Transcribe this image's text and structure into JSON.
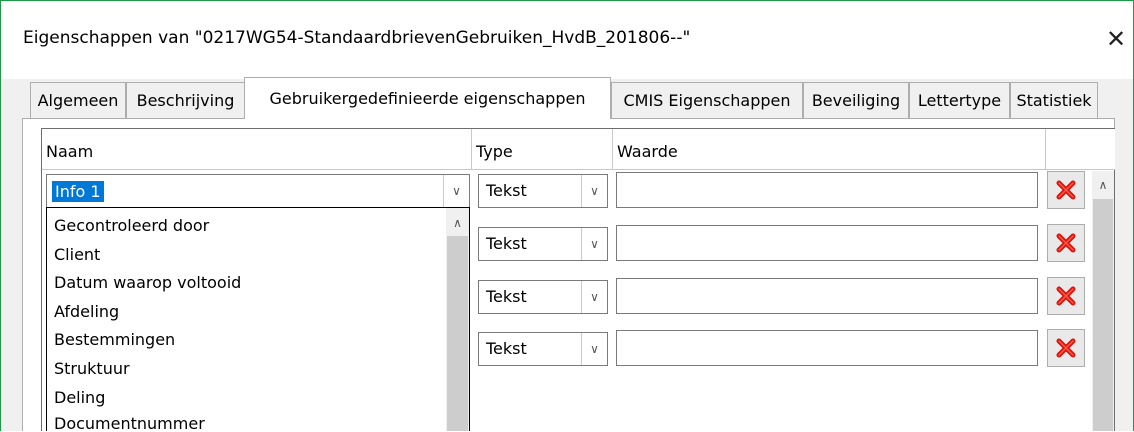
{
  "window": {
    "title": "Eigenschappen van \"0217WG54-StandaardbrievenGebruiken_HvdB_201806--\"",
    "close_glyph": "✕"
  },
  "tabs": [
    {
      "label": "Algemeen"
    },
    {
      "label": "Beschrijving"
    },
    {
      "label": "Gebruikergedefinieerde eigenschappen",
      "active": true
    },
    {
      "label": "CMIS Eigenschappen"
    },
    {
      "label": "Beveiliging"
    },
    {
      "label": "Lettertype"
    },
    {
      "label": "Statistiek"
    }
  ],
  "table": {
    "headers": {
      "name": "Naam",
      "type": "Type",
      "value": "Waarde"
    },
    "rows": [
      {
        "name": "Info 1",
        "type": "Tekst",
        "value": ""
      },
      {
        "name": "",
        "type": "Tekst",
        "value": ""
      },
      {
        "name": "",
        "type": "Tekst",
        "value": ""
      },
      {
        "name": "",
        "type": "Tekst",
        "value": ""
      }
    ]
  },
  "name_dropdown": {
    "options": [
      "Gecontroleerd door",
      "Client",
      "Datum waarop voltooid",
      "Afdeling",
      "Bestemmingen",
      "Struktuur",
      "Deling",
      "Documentnummer"
    ]
  },
  "icons": {
    "delete": "red-x-icon",
    "chevron": "chevron-down-icon",
    "scroll_up": "chevron-up-icon"
  },
  "colors": {
    "window_border": "#1d9a45",
    "selection": "#0078d7",
    "delete_red": "#d9140f"
  }
}
